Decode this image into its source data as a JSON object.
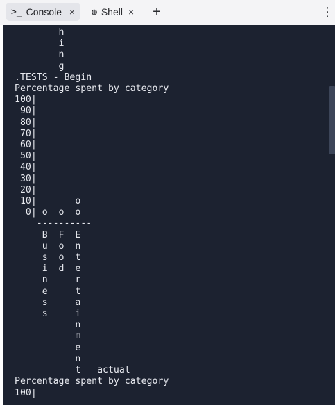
{
  "tabs": [
    {
      "icon": "terminal-icon",
      "glyph": ">_",
      "label": "Console",
      "close": "×",
      "active": true
    },
    {
      "icon": "shell-icon",
      "glyph": "◍",
      "label": "Shell",
      "close": "×",
      "active": false
    }
  ],
  "new_tab": "+",
  "menu": "⋮",
  "console_text": "        h\n        i\n        n\n        g\n.TESTS - Begin\nPercentage spent by category\n100|\n 90|\n 80|\n 70|\n 60|\n 50|\n 40|\n 30|\n 20|\n 10|       o\n  0| o  o  o\n    ----------\n     B  F  E\n     u  o  n\n     s  o  t\n     i  d  e\n     n     r\n     e     t\n     s     a\n     s     i\n           n\n           m\n           e\n           n\n           t   actual\nPercentage spent by category\n100|",
  "colors": {
    "terminal_bg": "#1c2230",
    "terminal_fg": "#e6e8ee",
    "tabbar_bg": "#f4f4f6",
    "active_tab_bg": "#e4e5ea"
  }
}
